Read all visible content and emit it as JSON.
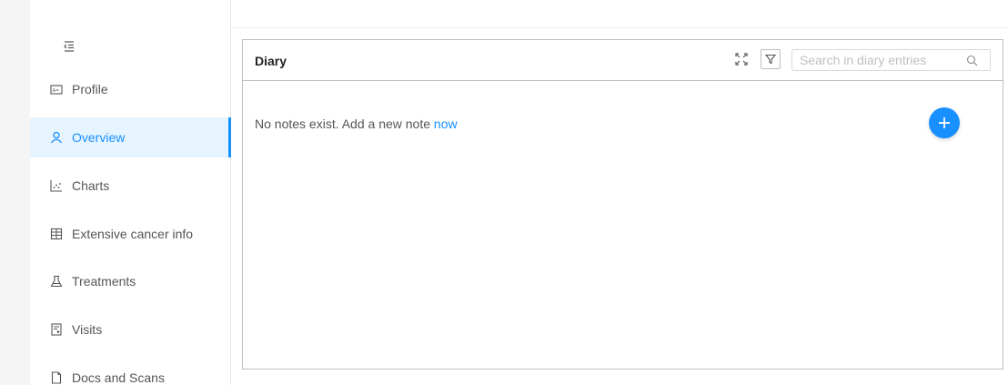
{
  "sidebar": {
    "items": [
      {
        "label": "Profile",
        "icon": "profile-card-icon",
        "active": false
      },
      {
        "label": "Overview",
        "icon": "user-icon",
        "active": true
      },
      {
        "label": "Charts",
        "icon": "scatter-chart-icon",
        "active": false
      },
      {
        "label": "Extensive cancer info",
        "icon": "building-icon",
        "active": false
      },
      {
        "label": "Treatments",
        "icon": "flask-icon",
        "active": false
      },
      {
        "label": "Visits",
        "icon": "clipboard-user-icon",
        "active": false
      },
      {
        "label": "Docs and Scans",
        "icon": "document-icon",
        "active": false
      }
    ]
  },
  "diary": {
    "title": "Diary",
    "search_placeholder": "Search in diary entries",
    "search_value": "",
    "empty_text": "No notes exist. Add a new note ",
    "empty_link": "now"
  },
  "colors": {
    "accent": "#1890ff",
    "active_bg": "#e6f4ff",
    "border": "#bfbfbf"
  }
}
